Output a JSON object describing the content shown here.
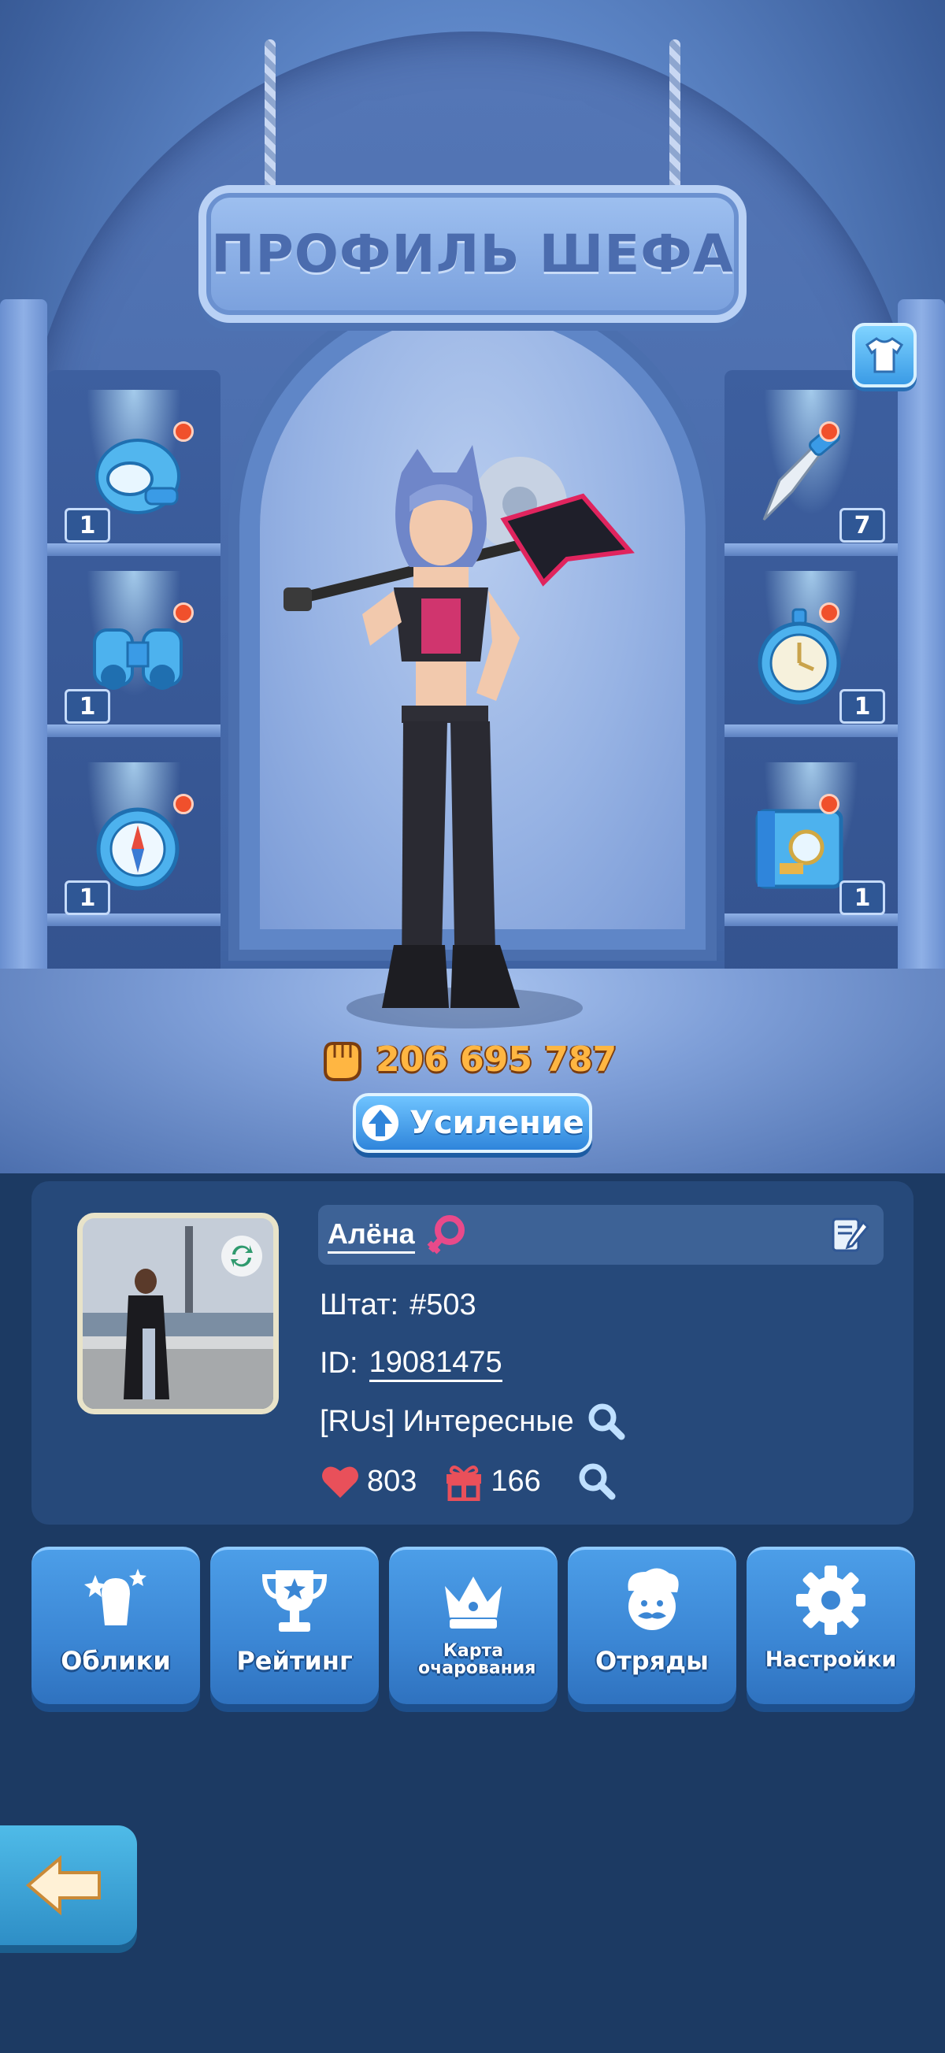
{
  "header": {
    "title": "ПРОФИЛЬ ШЕФА"
  },
  "equipment": {
    "left": [
      {
        "icon": "helmet-icon",
        "count": "1"
      },
      {
        "icon": "binoculars-icon",
        "count": "1"
      },
      {
        "icon": "compass-icon",
        "count": "1"
      }
    ],
    "right": [
      {
        "icon": "knife-icon",
        "count": "7"
      },
      {
        "icon": "timer-icon",
        "count": "1"
      },
      {
        "icon": "recipe-book-icon",
        "count": "1"
      }
    ]
  },
  "hero": {
    "power": "206 695 787"
  },
  "boost": {
    "label": "Усиление"
  },
  "profile": {
    "name": "Алёна",
    "staff_label": "Штат:",
    "staff_value": "#503",
    "id_label": "ID:",
    "id_value": "19081475",
    "team": "[RUs] Интересные",
    "likes": "803",
    "gifts": "166"
  },
  "menu": {
    "skins": "Облики",
    "rating": "Рейтинг",
    "charm_map": "Карта очарования",
    "squads": "Отряды",
    "settings": "Настройки"
  },
  "colors": {
    "accent": "#3b86d4",
    "power": "#ffb642",
    "badge": "#f0502c",
    "card": "#26497a",
    "background": "#1c3a63"
  }
}
